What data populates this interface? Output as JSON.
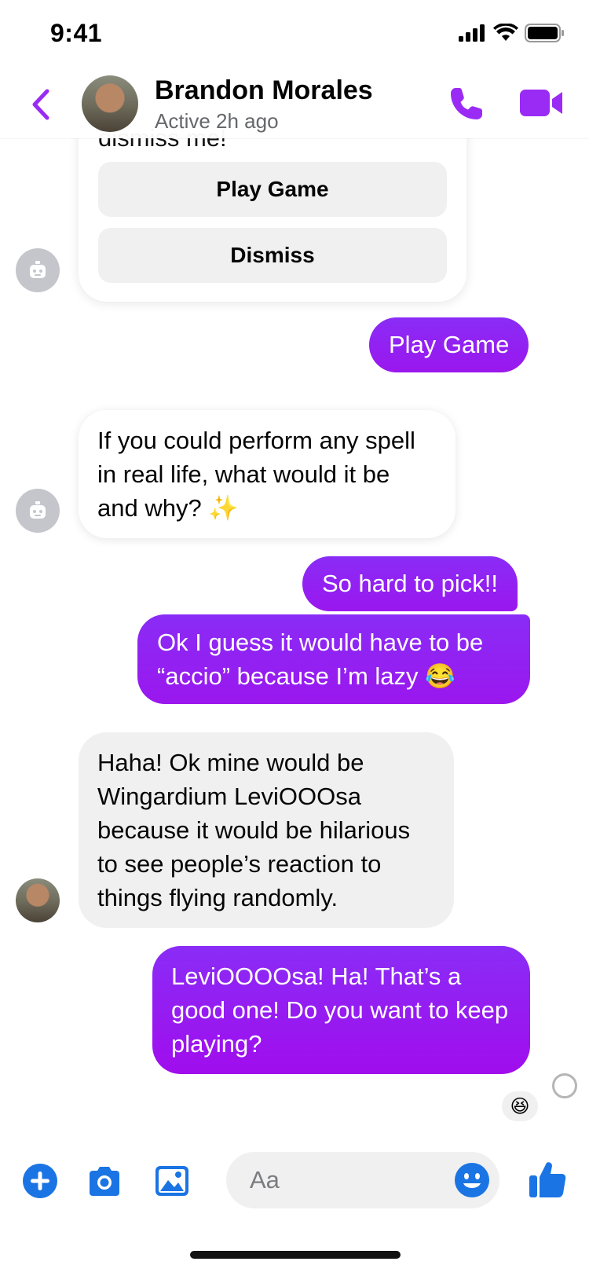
{
  "status_bar": {
    "time": "9:41"
  },
  "header": {
    "contact_name": "Brandon Morales",
    "contact_status": "Active 2h ago"
  },
  "bot_card": {
    "partial_text": "dismiss me!",
    "buttons": [
      "Play Game",
      "Dismiss"
    ]
  },
  "messages": [
    {
      "from": "me",
      "text": "Play Game"
    },
    {
      "from": "bot",
      "text": "If you could perform any spell in real life, what would it be and why? ✨"
    },
    {
      "from": "me",
      "text": "So hard to pick!!"
    },
    {
      "from": "me",
      "text": "Ok I guess it would have to be “accio” because I’m lazy 😂"
    },
    {
      "from": "contact",
      "text": "Haha! Ok mine would be Wingardium LeviOOOsa because it would be hilarious to see people’s reaction to things flying randomly."
    },
    {
      "from": "me",
      "text": "LeviOOOOsa! Ha! That’s a good one! Do you want to keep playing?"
    }
  ],
  "reaction": {
    "emoji": "😆"
  },
  "composer": {
    "placeholder": "Aa"
  },
  "colors": {
    "accent_purple": "#9a2bf5",
    "messenger_blue": "#1b74e4",
    "incoming_grey": "#f0f0f0",
    "secondary_text": "#65676b"
  }
}
